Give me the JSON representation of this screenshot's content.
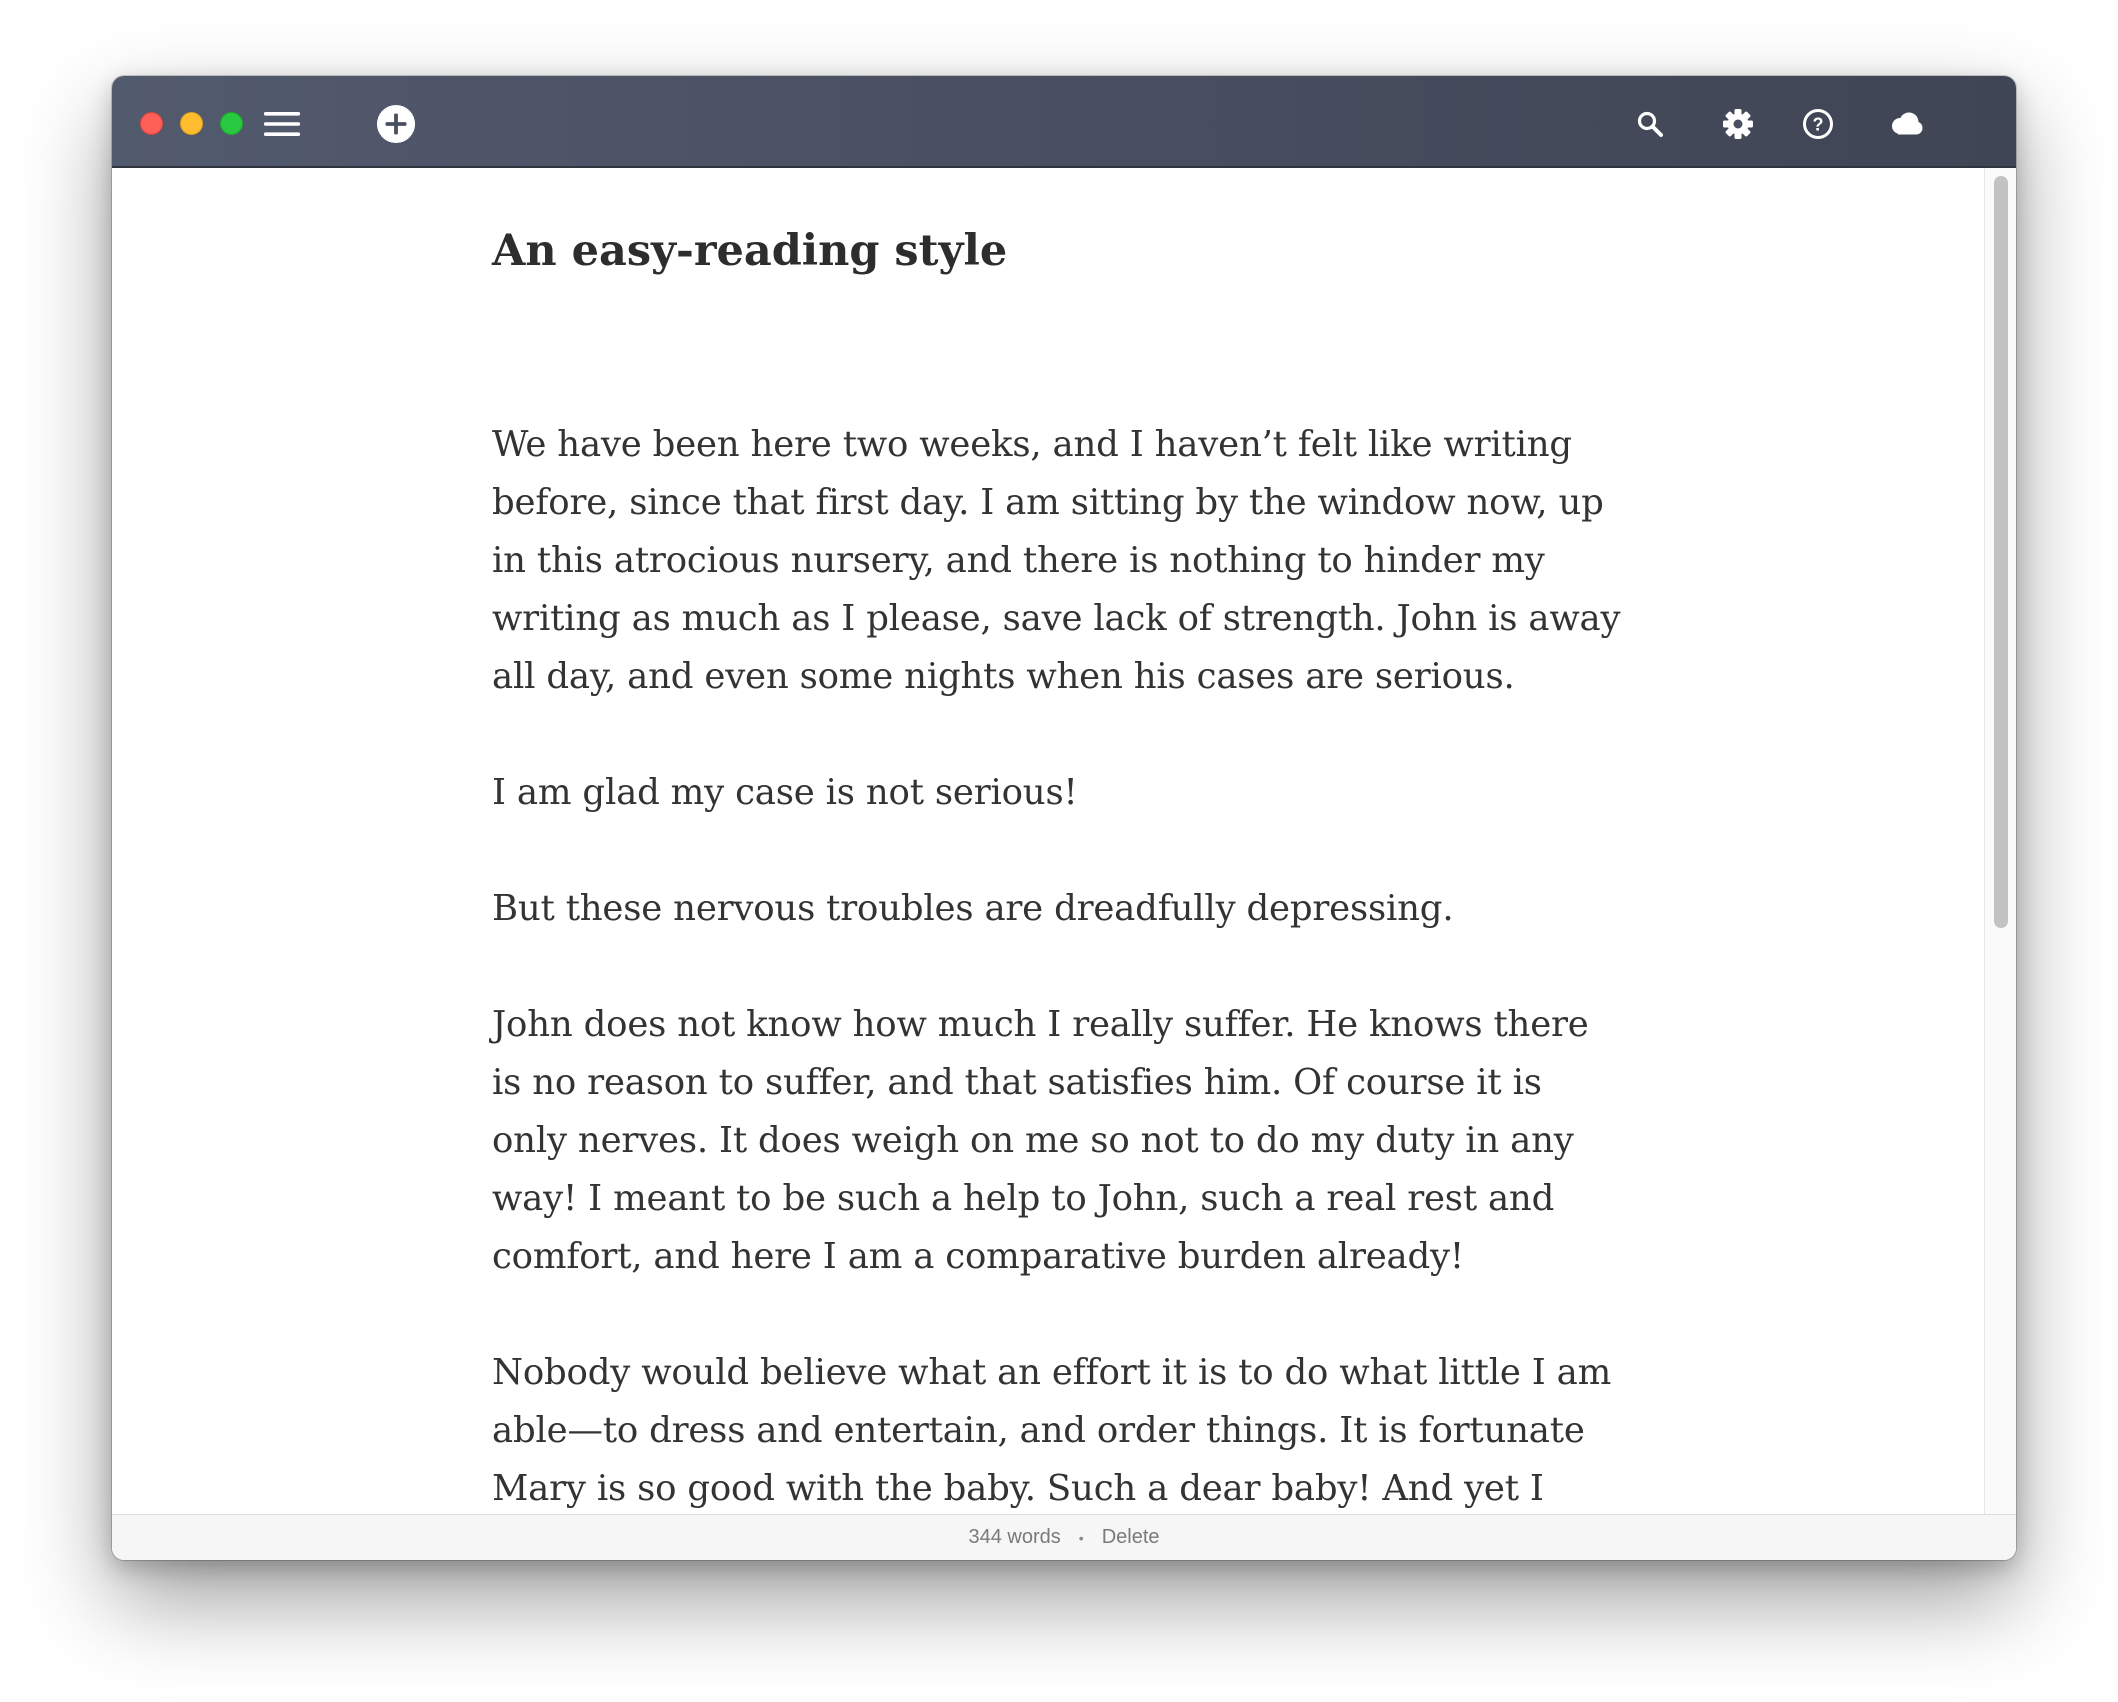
{
  "window": {
    "title_icons": [
      "menu-icon",
      "add-icon",
      "search-icon",
      "gear-icon",
      "help-icon",
      "cloud-icon"
    ]
  },
  "document": {
    "heading": "An easy-reading style",
    "paragraphs": [
      "We have been here two weeks, and I haven’t felt like writing before, since that first day. I am sitting by the window now, up in this atrocious nursery, and there is nothing to hinder my writing as much as I please, save lack of strength. John is away all day, and even some nights when his cases are serious.",
      "I am glad my case is not serious!",
      "But these nervous troubles are dreadfully depressing.",
      "John does not know how much I really suffer. He knows there is no reason to suffer, and that satisfies him. Of course it is only nerves. It does weigh on me so not to do my duty in any way! I meant to be such a help to John, such a real rest and comfort, and here I am a comparative burden already!",
      "Nobody would believe what an effort it is to do what little I am able—to dress and entertain, and order things. It is fortunate Mary is so good with the baby. Such a dear baby! And yet I cannot be with him, it makes me so nervous."
    ]
  },
  "status": {
    "word_count": "344 words",
    "separator": "•",
    "delete_label": "Delete"
  },
  "colors": {
    "titlebar": "#4a5062",
    "text": "#333333",
    "close": "#fe5f57",
    "minimize": "#febc2e",
    "zoom": "#28c840"
  }
}
